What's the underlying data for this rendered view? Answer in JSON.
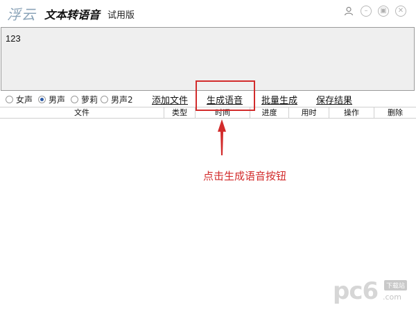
{
  "titlebar": {
    "logo": "浮云",
    "title": "文本转语音",
    "edition": "试用版",
    "controls": {
      "user_icon": "user-icon",
      "minimize_icon": "minimize-icon",
      "restore_icon": "restore-icon",
      "close_icon": "close-icon"
    }
  },
  "editor": {
    "value": "123"
  },
  "voices": [
    {
      "label": "女声",
      "checked": false
    },
    {
      "label": "男声",
      "checked": true
    },
    {
      "label": "萝莉",
      "checked": false
    },
    {
      "label": "男声2",
      "checked": false
    }
  ],
  "actions": {
    "add_file": "添加文件",
    "generate": "生成语音",
    "batch": "批量生成",
    "save": "保存结果"
  },
  "table": {
    "columns": [
      "文件",
      "类型",
      "时间",
      "进度",
      "用时",
      "操作",
      "删除"
    ],
    "rows": []
  },
  "annotation": {
    "text": "点击生成语音按钮",
    "color": "#d22b2b"
  },
  "watermark": {
    "brand": "pc6",
    "tag": "下载站",
    "domain": ".com"
  }
}
